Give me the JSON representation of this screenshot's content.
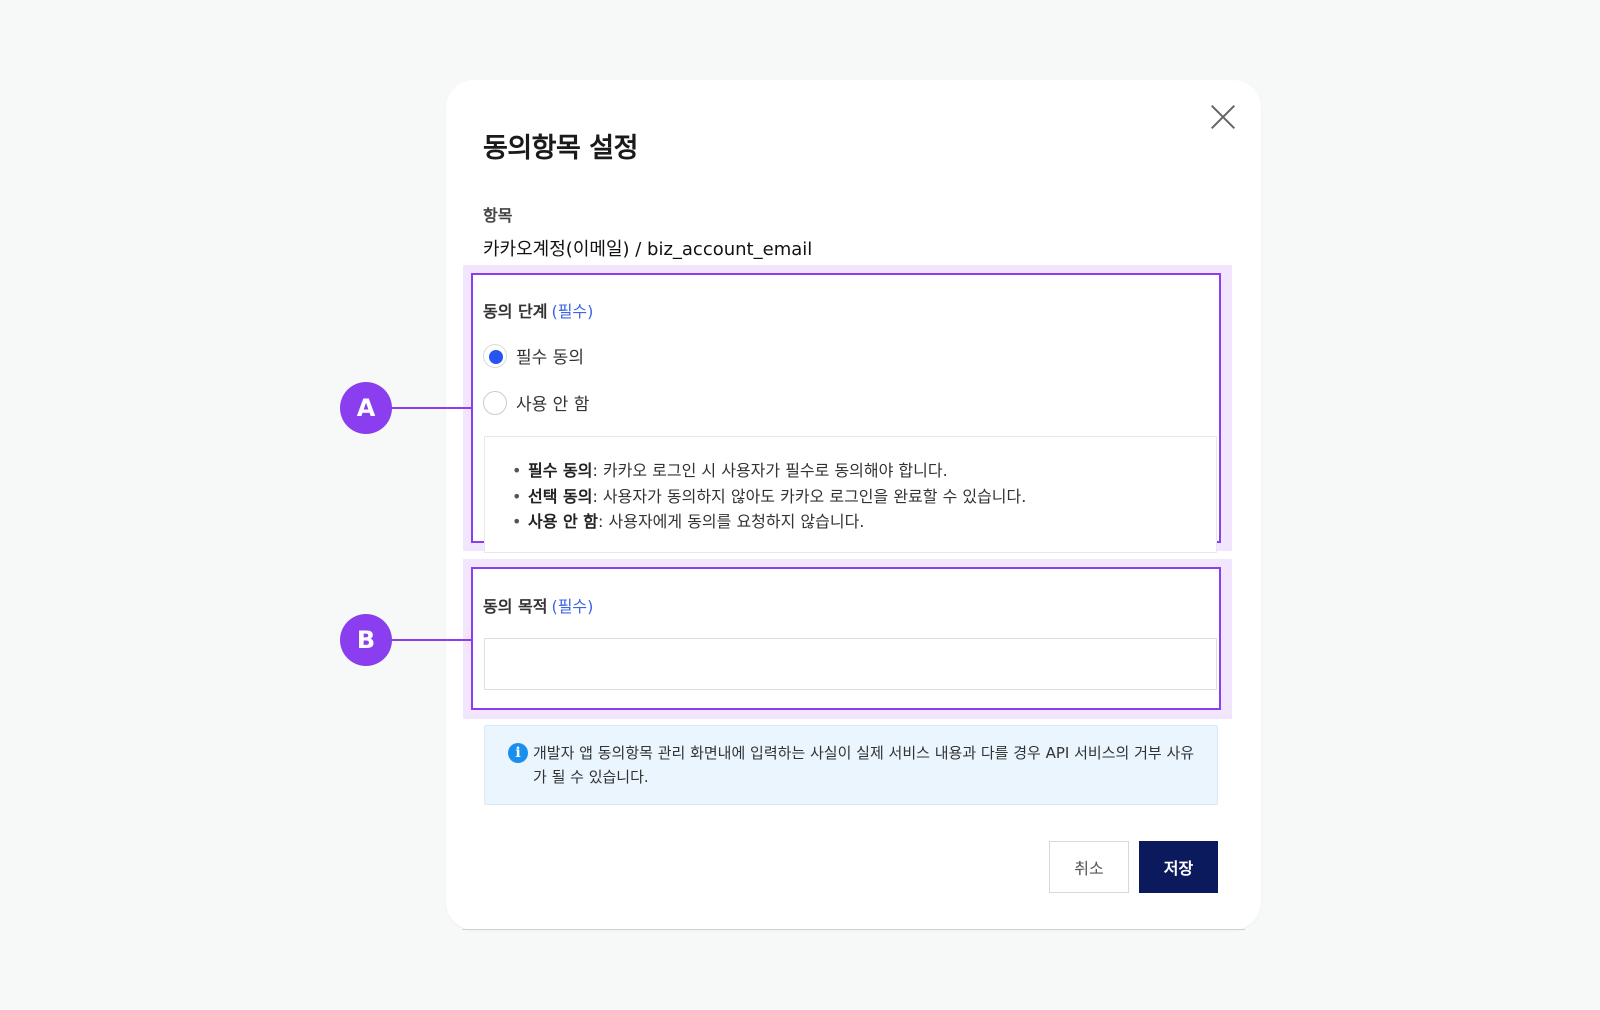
{
  "dialog": {
    "title": "동의항목 설정",
    "item_label": "항목",
    "item_value": "카카오계정(이메일) / biz_account_email"
  },
  "consent_level": {
    "label": "동의 단계",
    "required_tag": "(필수)",
    "options": [
      {
        "label": "필수 동의",
        "selected": true
      },
      {
        "label": "사용 안 함",
        "selected": false
      }
    ],
    "descriptions": [
      {
        "bullet": "•",
        "term": "필수 동의",
        "text": ": 카카오 로그인 시 사용자가 필수로 동의해야 합니다."
      },
      {
        "bullet": "•",
        "term": "선택 동의",
        "text": ": 사용자가 동의하지 않아도 카카오 로그인을 완료할 수 있습니다."
      },
      {
        "bullet": "•",
        "term": "사용 안 함",
        "text": ": 사용자에게 동의를 요청하지 않습니다."
      }
    ]
  },
  "consent_purpose": {
    "label": "동의 목적",
    "required_tag": "(필수)",
    "value": ""
  },
  "notice": {
    "icon": "i",
    "text": "개발자 앱 동의항목 관리 화면내에 입력하는 사실이 실제 서비스 내용과 다를 경우 API 서비스의 거부 사유가 될 수 있습니다."
  },
  "buttons": {
    "cancel": "취소",
    "save": "저장"
  },
  "annotations": {
    "a": "A",
    "b": "B"
  },
  "colors": {
    "accent_purple": "#8a3ef0",
    "highlight_bg": "#f1e6fd",
    "radio_blue": "#2753f0",
    "required_blue": "#3d64e6",
    "save_button": "#0b1a5c",
    "notice_bg": "#eaf5fd"
  }
}
